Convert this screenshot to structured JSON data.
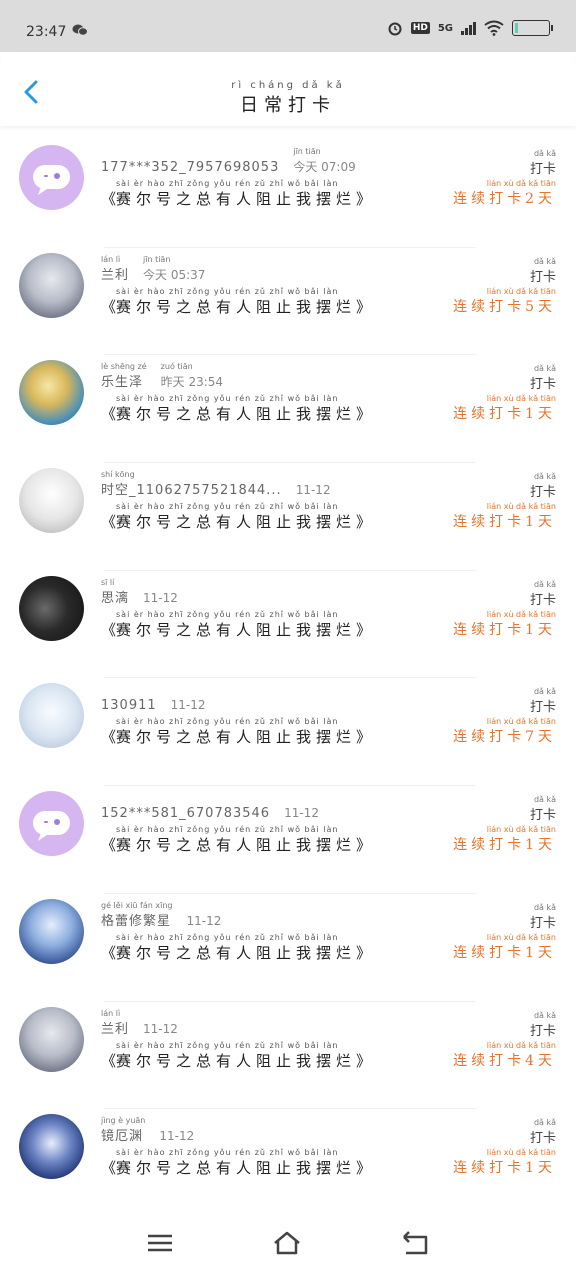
{
  "status_bar": {
    "time": "23:47",
    "network": "5G"
  },
  "header": {
    "title_pinyin": "rì cháng dǎ kǎ",
    "title": "日常打卡"
  },
  "message_pinyin": "sài èr hào zhī zǒng yǒu rén zǔ zhǐ wǒ bǎi làn",
  "message": "赛尔号之总有人阻止我摆烂",
  "checkin_pinyin": "dǎ kǎ",
  "checkin_label": "打卡",
  "streak_pinyin": "lián xù dǎ kǎ tiān",
  "entries": [
    {
      "name_pinyin": "",
      "name": "177***352_7957698053",
      "time_pinyin": "jīn tiān",
      "time": "今天 07:09",
      "streak": "连续打卡2天",
      "avatar": "default"
    },
    {
      "name_pinyin": "lán lì",
      "name": "兰利",
      "time_pinyin": "jīn tiān",
      "time": "今天 05:37",
      "streak": "连续打卡5天",
      "avatar": "anime-silver"
    },
    {
      "name_pinyin": "lè shēng zé",
      "name": "乐生泽",
      "time_pinyin": "zuó tiān",
      "time": "昨天 23:54",
      "streak": "连续打卡1天",
      "avatar": "anime-blonde"
    },
    {
      "name_pinyin": "shí kōng",
      "name": "时空_11062757521844...",
      "time_pinyin": "",
      "time": "11-12",
      "streak": "连续打卡1天",
      "avatar": "anime-white"
    },
    {
      "name_pinyin": "sī lí",
      "name": "思漓",
      "time_pinyin": "",
      "time": "11-12",
      "streak": "连续打卡1天",
      "avatar": "dark"
    },
    {
      "name_pinyin": "",
      "name": "130911",
      "time_pinyin": "",
      "time": "11-12",
      "streak": "连续打卡7天",
      "avatar": "anime-pale"
    },
    {
      "name_pinyin": "",
      "name": "152***581_670783546",
      "time_pinyin": "",
      "time": "11-12",
      "streak": "连续打卡1天",
      "avatar": "default"
    },
    {
      "name_pinyin": "gé lěi xiū fán xīng",
      "name": "格蕾修繁星",
      "time_pinyin": "",
      "time": "11-12",
      "streak": "连续打卡1天",
      "avatar": "anime-blue"
    },
    {
      "name_pinyin": "lán lì",
      "name": "兰利",
      "time_pinyin": "",
      "time": "11-12",
      "streak": "连续打卡4天",
      "avatar": "anime-silver"
    },
    {
      "name_pinyin": "jìng è yuān",
      "name": "镜厄渊",
      "time_pinyin": "",
      "time": "11-12",
      "streak": "连续打卡1天",
      "avatar": "anime-navy"
    }
  ],
  "colors": {
    "accent_blue": "#2a9be0",
    "streak_orange": "#e8742c",
    "default_avatar": "#d5b6f0"
  },
  "nav": {
    "icons": [
      "menu-icon",
      "home-icon",
      "back-nav-icon"
    ]
  }
}
